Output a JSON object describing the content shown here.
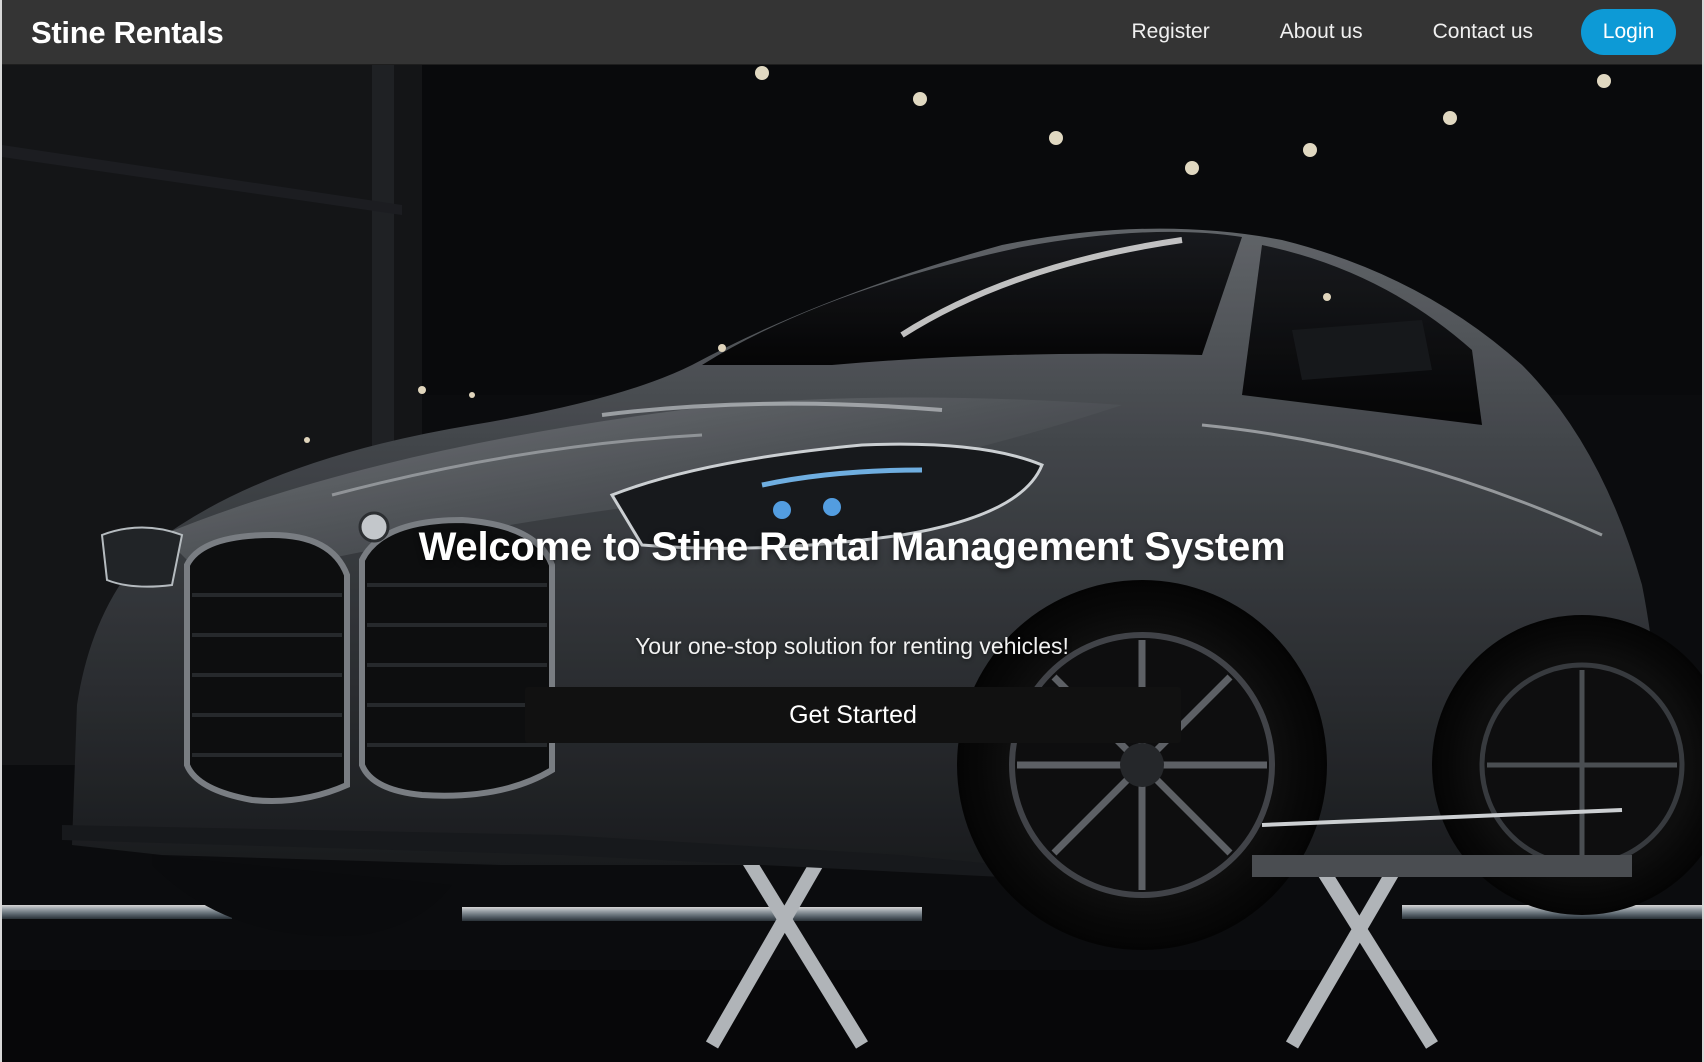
{
  "navbar": {
    "brand": "Stine Rentals",
    "links": [
      {
        "label": "Register"
      },
      {
        "label": "About us"
      },
      {
        "label": "Contact us"
      }
    ],
    "login_label": "Login",
    "background_color": "#343434",
    "login_color": "#0d9ad6"
  },
  "hero": {
    "title": "Welcome to Stine Rental Management System",
    "subtitle": "Your one-stop solution for renting vehicles!",
    "cta_label": "Get Started",
    "cta_color": "#111111",
    "background_image": "dark-grey-sports-sedan-on-lift-showroom"
  }
}
